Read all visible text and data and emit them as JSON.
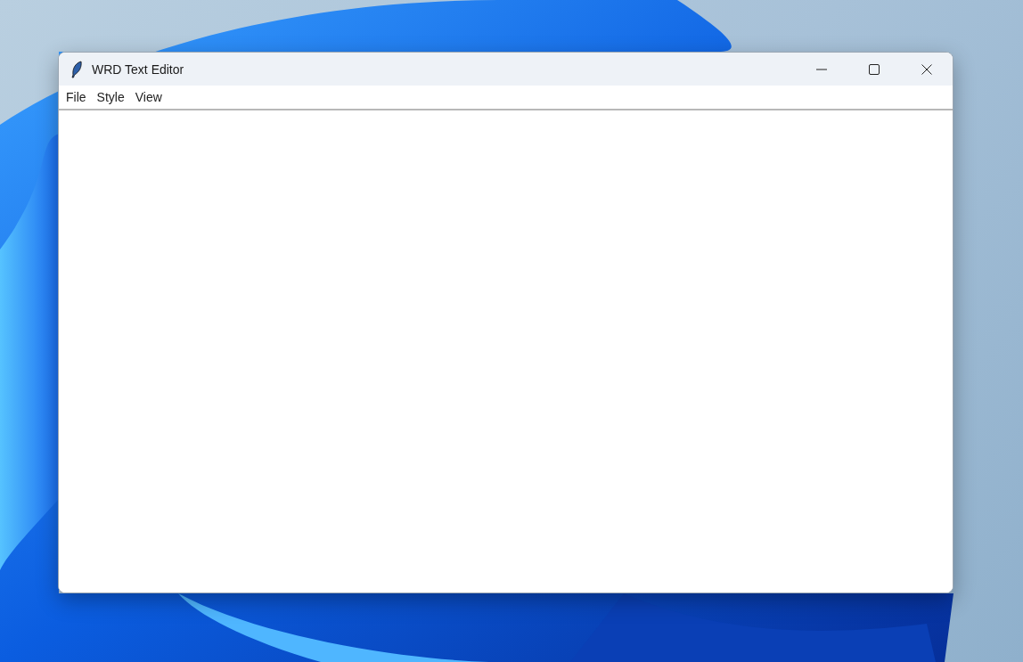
{
  "window": {
    "title": "WRD Text Editor"
  },
  "menu": [
    "File",
    "Style",
    "View"
  ]
}
